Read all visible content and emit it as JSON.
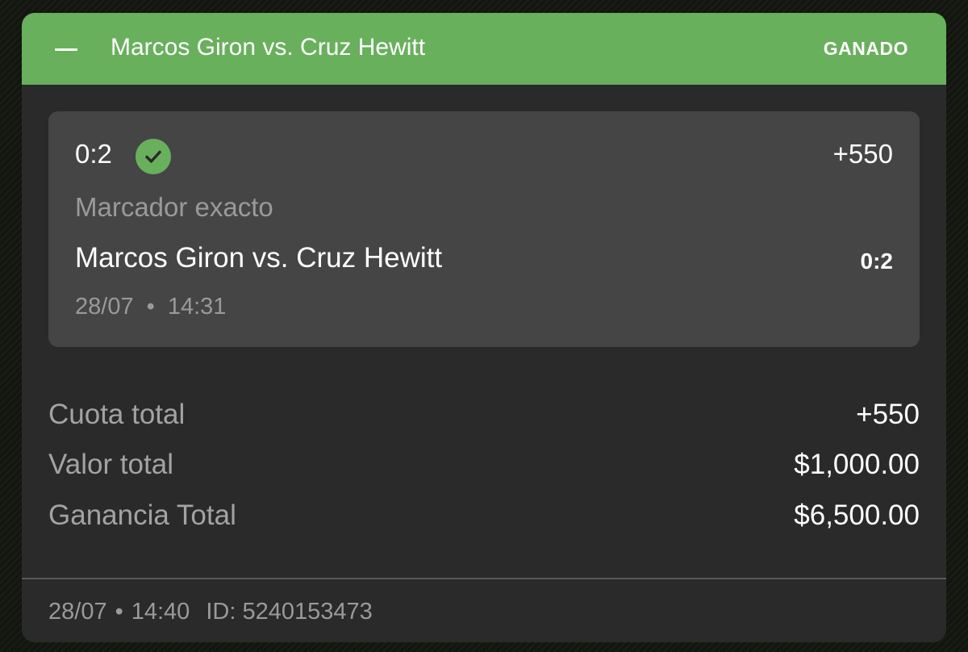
{
  "bet": {
    "header": {
      "title": "Marcos Giron vs. Cruz Hewitt",
      "status": "GANADO",
      "icon": "minus-collapse-icon"
    },
    "selection": {
      "pick": "0:2",
      "status_icon": "check-circle-icon",
      "odds": "+550",
      "market": "Marcador exacto",
      "event": "Marcos Giron vs. Cruz Hewitt",
      "result": "0:2",
      "date": "28/07",
      "time": "14:31"
    },
    "summary": [
      {
        "label": "Cuota total",
        "value": "+550"
      },
      {
        "label": "Valor total",
        "value": "$1,000.00"
      },
      {
        "label": "Ganancia Total",
        "value": "$6,500.00"
      }
    ],
    "footer": {
      "date": "28/07",
      "separator": "•",
      "time": "14:40",
      "id_label": "ID:",
      "id_value": "5240153473"
    }
  },
  "colors": {
    "header_bg": "#69b05d",
    "card_bg": "#2a2a2a",
    "selection_bg": "#454545",
    "muted_text": "#9a9a9a",
    "text": "#ffffff"
  }
}
